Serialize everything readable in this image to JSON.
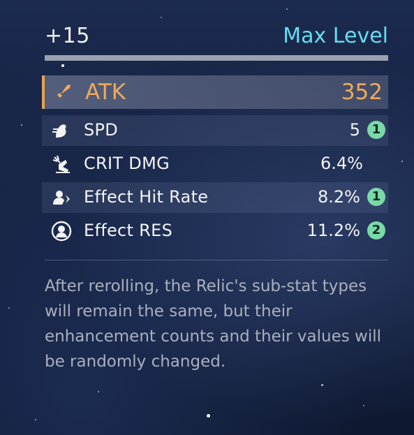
{
  "header": {
    "level": "+15",
    "status": "Max Level"
  },
  "main_stat": {
    "icon": "sword-icon",
    "name": "ATK",
    "value": "352",
    "color": "#f2a95a"
  },
  "sub_stats": [
    {
      "icon": "speed-boot-icon",
      "name": "SPD",
      "value": "5",
      "rolls": "1"
    },
    {
      "icon": "crit-damage-icon",
      "name": "CRIT DMG",
      "value": "6.4%",
      "rolls": ""
    },
    {
      "icon": "effect-hit-icon",
      "name": "Effect Hit Rate",
      "value": "8.2%",
      "rolls": "1"
    },
    {
      "icon": "effect-res-icon",
      "name": "Effect RES",
      "value": "11.2%",
      "rolls": "2"
    }
  ],
  "description": "After rerolling, the Relic's sub-stat types will remain the same, but their enhancement counts and their values will be randomly changed.",
  "colors": {
    "accent": "#e6a44f",
    "max_level": "#66dcf0",
    "badge": "#79d9a8"
  }
}
